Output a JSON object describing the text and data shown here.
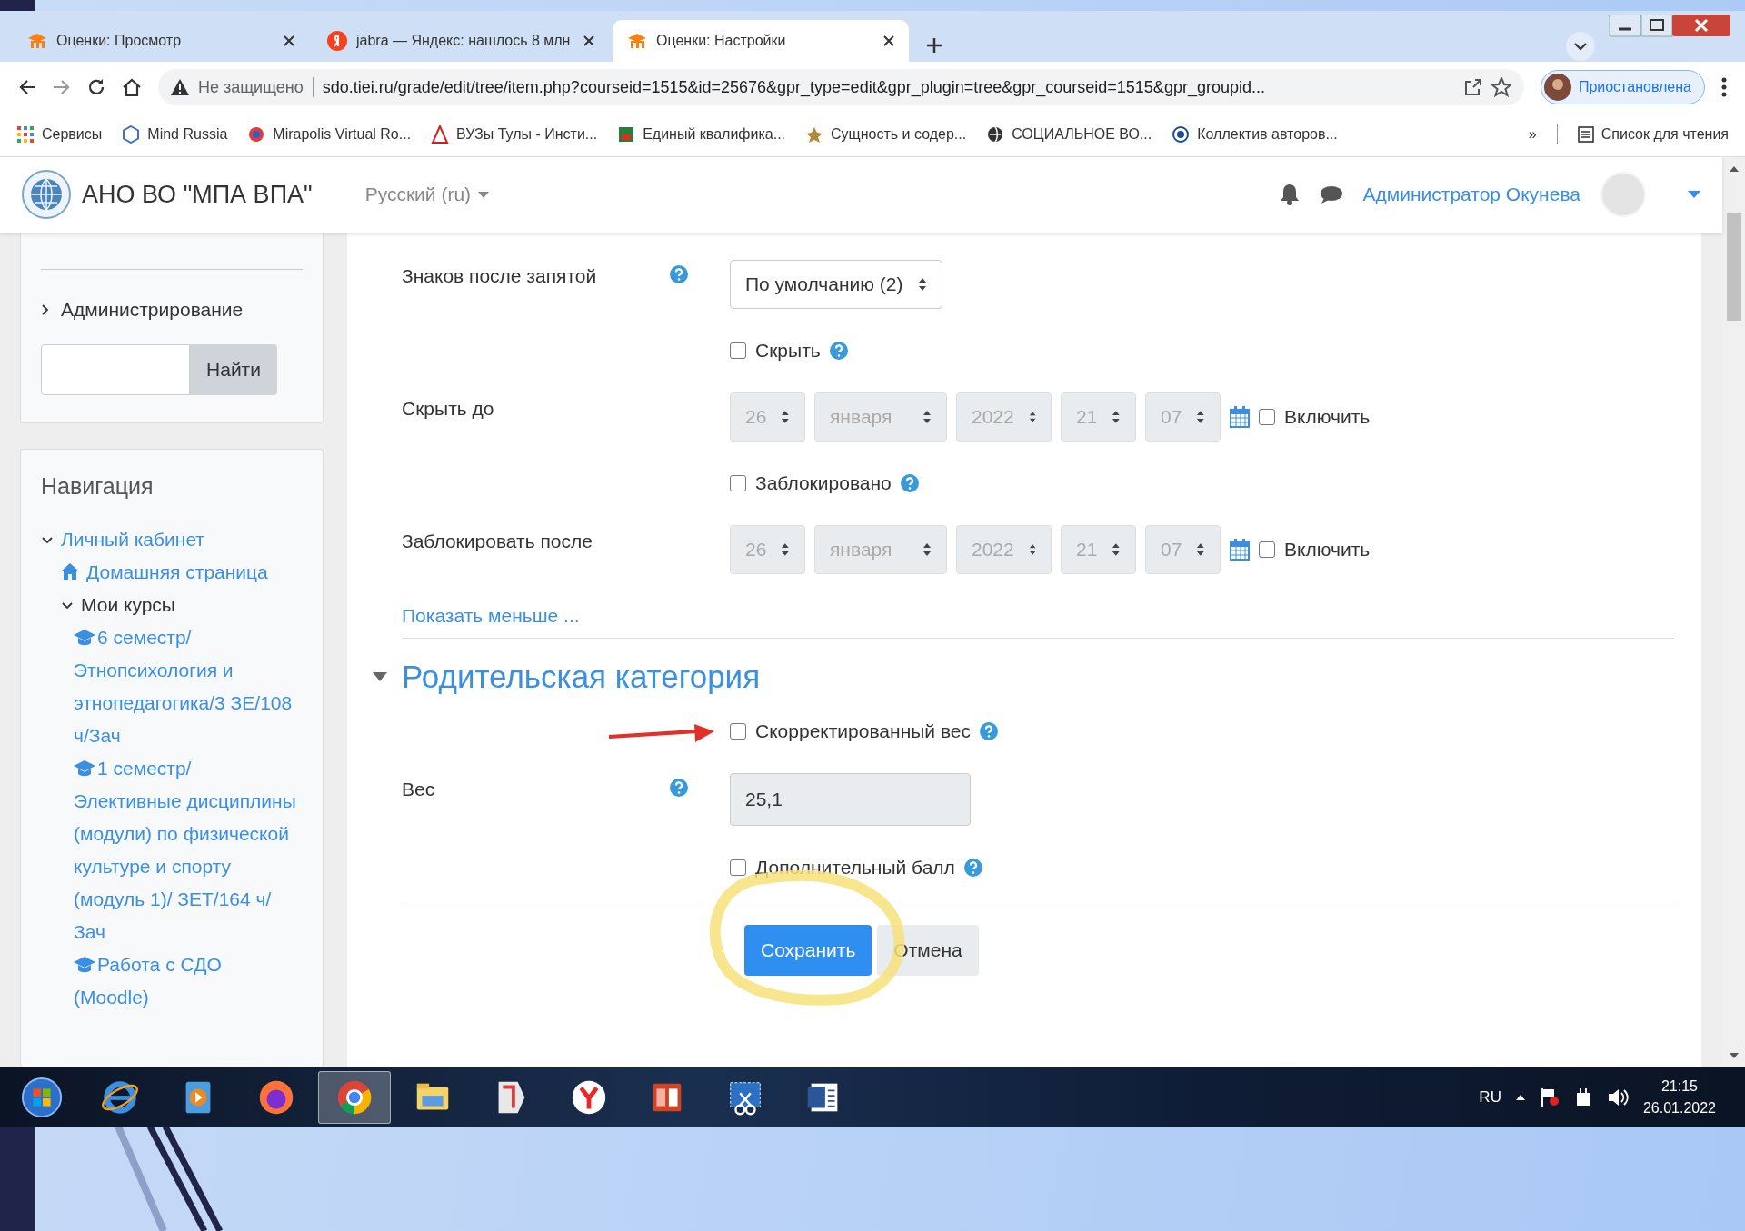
{
  "browser": {
    "tabs": [
      {
        "title": "Оценки: Просмотр",
        "kind": "moodle",
        "selected": false
      },
      {
        "title": "jabra — Яндекс: нашлось 8 млн",
        "kind": "yandex",
        "selected": false
      },
      {
        "title": "Оценки: Настройки",
        "kind": "moodle",
        "selected": true
      }
    ],
    "security_label": "Не защищено",
    "url": "sdo.tiei.ru/grade/edit/tree/item.php?courseid=1515&id=25676&gpr_type=edit&gpr_plugin=tree&gpr_courseid=1515&gpr_groupid...",
    "profile_label": "Приостановлена",
    "bookmarks": [
      {
        "label": "Сервисы",
        "kind": "apps"
      },
      {
        "label": "Mind Russia",
        "kind": "hexagon"
      },
      {
        "label": "Mirapolis Virtual Ro...",
        "kind": "flower"
      },
      {
        "label": "ВУЗы Тулы - Инсти...",
        "kind": "tower"
      },
      {
        "label": "Единый квалифика...",
        "kind": "square"
      },
      {
        "label": "Сущность и содер...",
        "kind": "emblem"
      },
      {
        "label": "СОЦИАЛЬНОЕ ВО...",
        "kind": "globe"
      },
      {
        "label": "Коллектив авторов...",
        "kind": "circle"
      }
    ],
    "bookmarks_overflow": "»",
    "reading_list": "Список для чтения"
  },
  "site": {
    "name": "АНО ВО \"МПА ВПА\"",
    "language": "Русский (ru)",
    "user_name": "Администратор Окунева"
  },
  "sidebar": {
    "admin_item": "Администрирование",
    "search_button": "Найти",
    "navigation_title": "Навигация",
    "tree": [
      {
        "label": "Личный кабинет",
        "kind": "link",
        "expanded": true,
        "children": [
          {
            "label": "Домашняя страница",
            "kind": "home"
          },
          {
            "label": "Мои курсы",
            "kind": "folder",
            "expanded": true,
            "children": [
              {
                "label": "6 семестр/ Этнопсихология и этнопедагогика/3 ЗЕ/108 ч/Зач",
                "kind": "course"
              },
              {
                "label": "1 семестр/ Элективные дисциплины (модули) по физической культуре и спорту (модуль 1)/ ЗЕТ/164 ч/ Зач",
                "kind": "course"
              },
              {
                "label": "Работа с СДО (Moodle)",
                "kind": "course"
              }
            ]
          }
        ]
      }
    ]
  },
  "form": {
    "rows": [
      {
        "kind": "select",
        "label": "Знаков после запятой",
        "help": true,
        "value": "По умолчанию (2)"
      },
      {
        "kind": "checkbox",
        "text": "Скрыть",
        "help": true,
        "checked": false,
        "arrow": false
      },
      {
        "kind": "date",
        "label": "Скрыть до",
        "day": "26",
        "month": "января",
        "year": "2022",
        "hour": "21",
        "minute": "07",
        "enable_label": "Включить",
        "enabled": false
      },
      {
        "kind": "checkbox",
        "text": "Заблокировано",
        "help": true,
        "checked": false,
        "arrow": false
      },
      {
        "kind": "date",
        "label": "Заблокировать после",
        "day": "26",
        "month": "января",
        "year": "2022",
        "hour": "21",
        "minute": "07",
        "enable_label": "Включить",
        "enabled": false
      },
      {
        "kind": "link",
        "text": "Показать меньше ..."
      },
      {
        "kind": "section",
        "title": "Родительская категория",
        "expanded": true
      },
      {
        "kind": "checkbox",
        "text": "Скорректированный вес",
        "help": true,
        "checked": false,
        "arrow": true
      },
      {
        "kind": "input",
        "label": "Вес",
        "help": true,
        "value": "25,1",
        "disabled": true
      },
      {
        "kind": "checkbox",
        "text": "Дополнительный балл",
        "help": true,
        "checked": false,
        "arrow": false
      }
    ],
    "buttons": [
      {
        "label": "Сохранить",
        "kind": "primary",
        "highlighted": true
      },
      {
        "label": "Отмена",
        "kind": "secondary",
        "highlighted": false
      }
    ]
  },
  "taskbar": {
    "apps": [
      {
        "kind": "start",
        "selected": false
      },
      {
        "kind": "ie",
        "selected": false
      },
      {
        "kind": "media",
        "selected": false
      },
      {
        "kind": "firefox",
        "selected": false
      },
      {
        "kind": "chrome",
        "selected": true
      },
      {
        "kind": "explorer",
        "selected": false
      },
      {
        "kind": "yandex",
        "selected": false
      },
      {
        "kind": "ybrowser",
        "selected": false
      },
      {
        "kind": "powerpoint",
        "selected": false
      },
      {
        "kind": "snipping",
        "selected": false
      },
      {
        "kind": "word",
        "selected": false
      }
    ],
    "language": "RU",
    "time": "21:15",
    "date": "26.01.2022"
  }
}
